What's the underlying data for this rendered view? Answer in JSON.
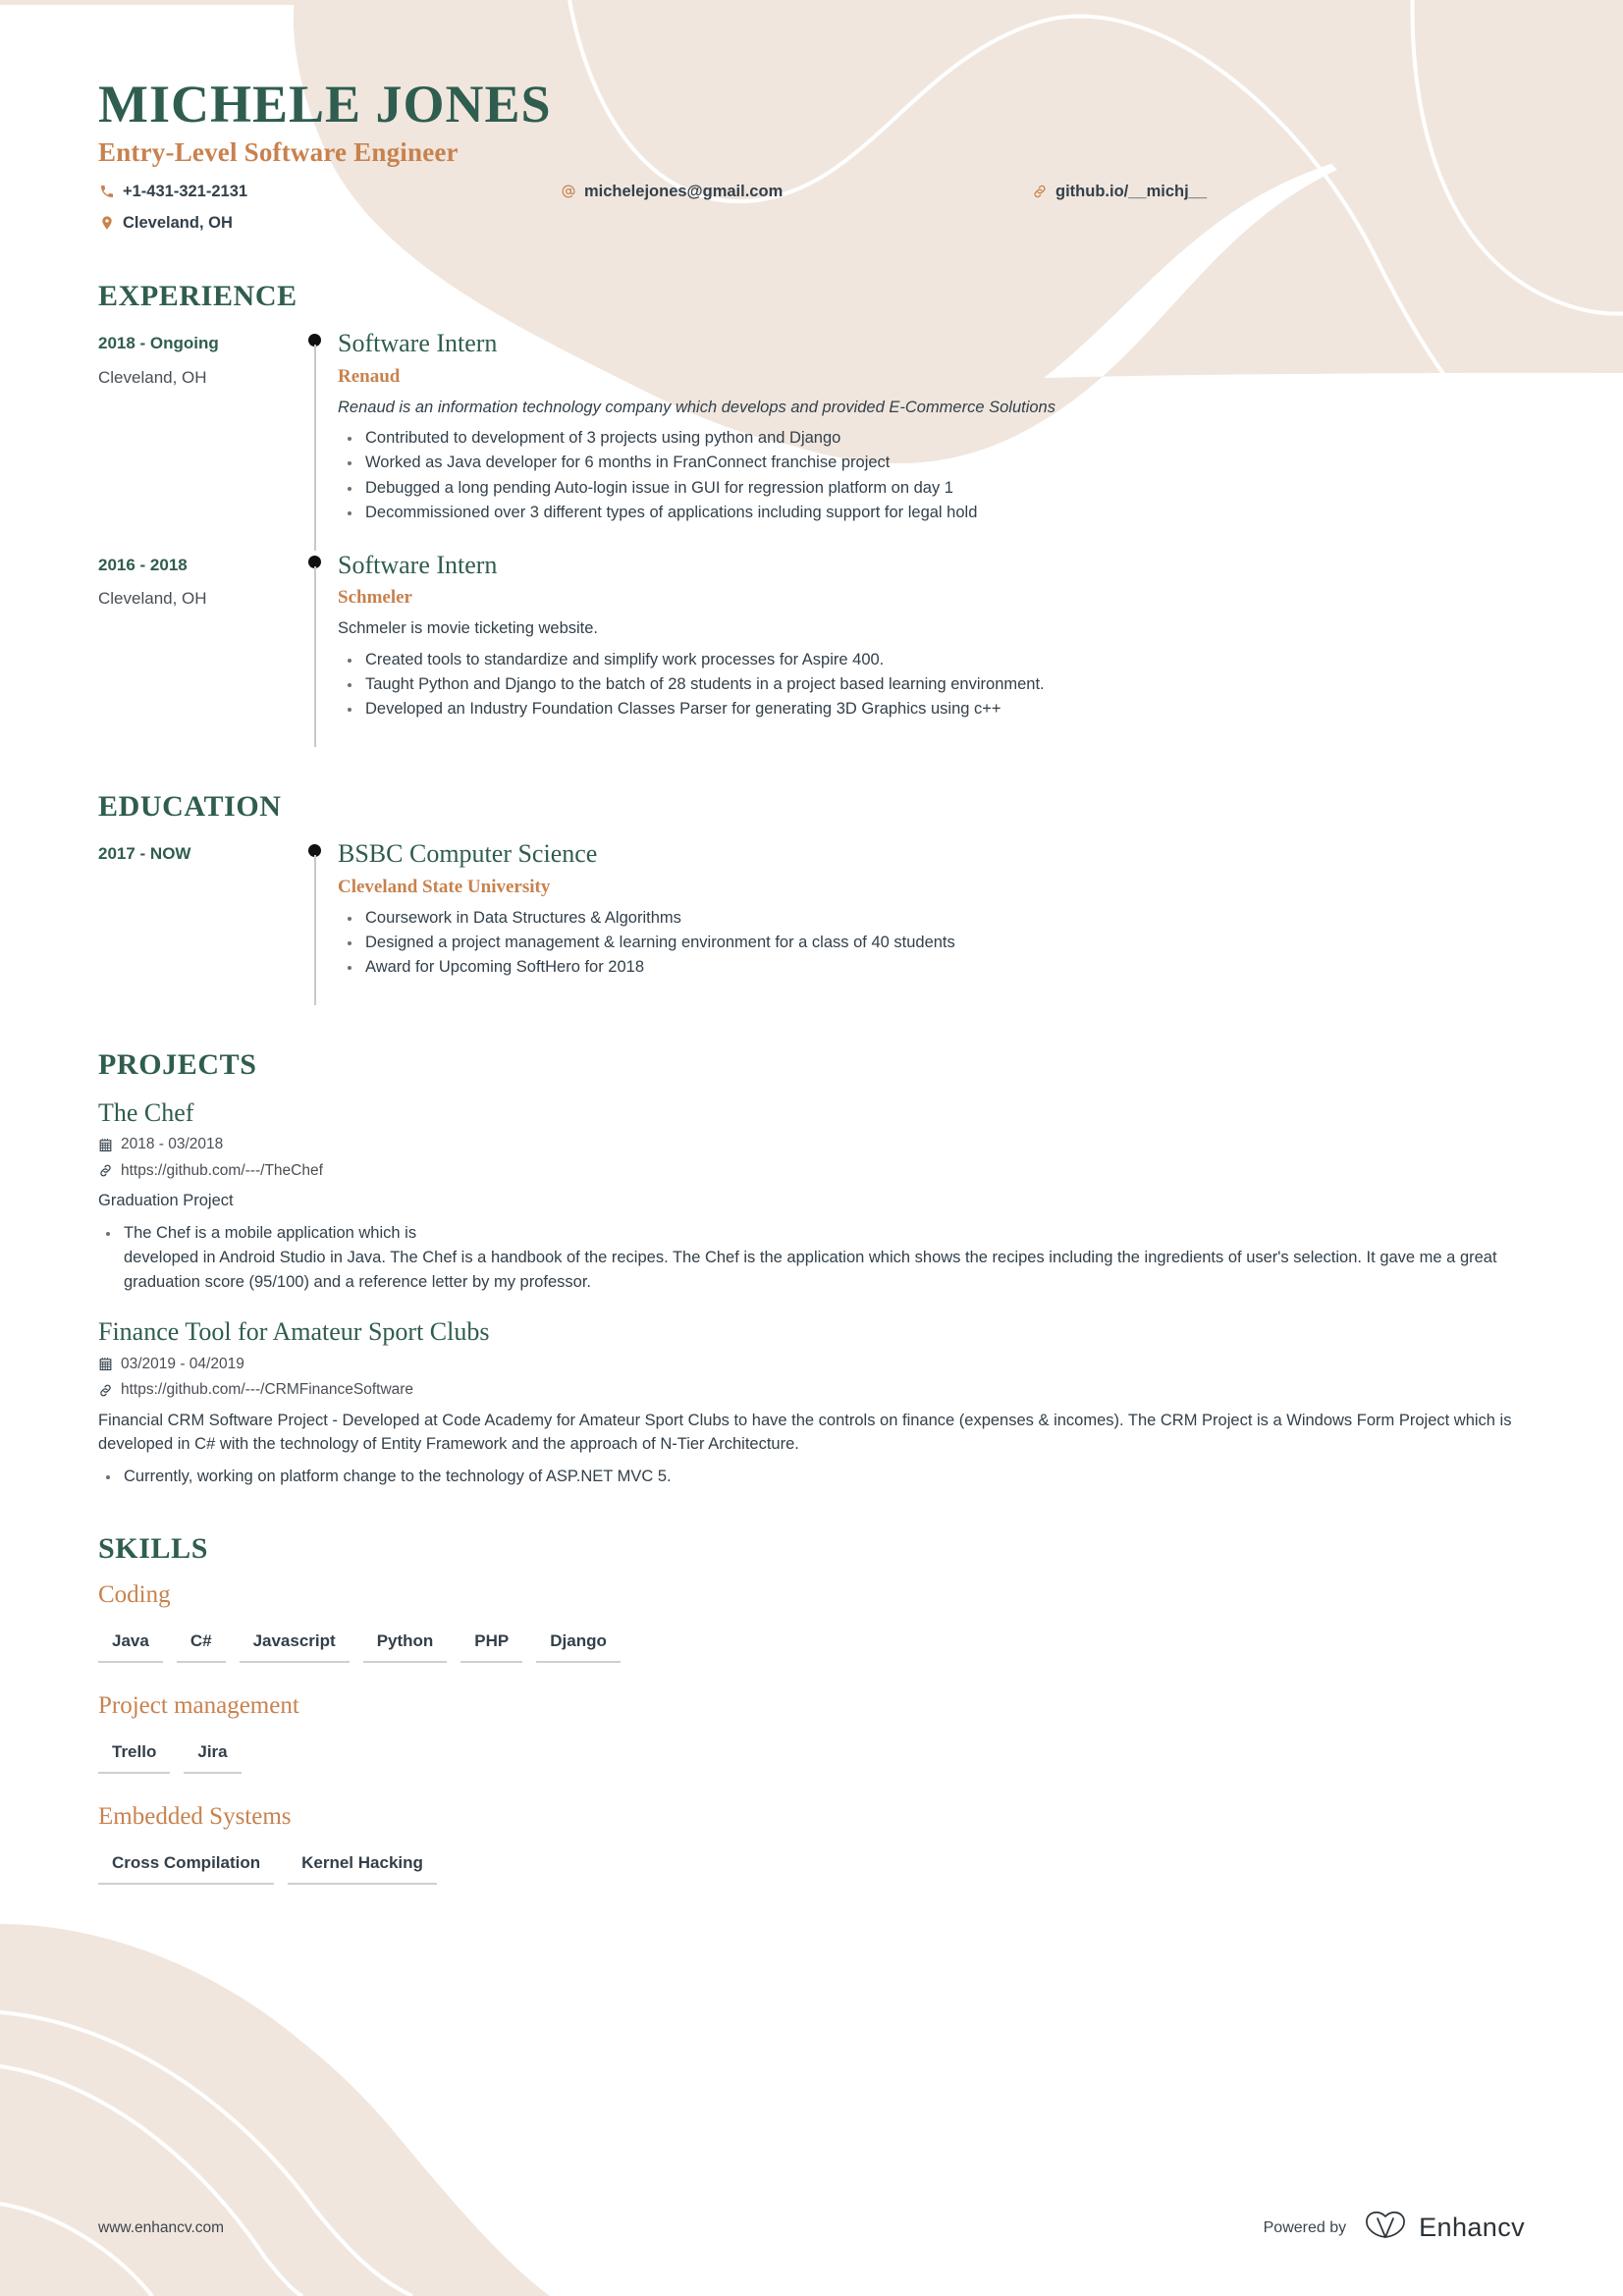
{
  "colors": {
    "green": "#2F5D50",
    "orange": "#C8824E",
    "beige": "#F0E6DE",
    "text": "#33404A",
    "rule": "#CFCFCF"
  },
  "header": {
    "name": "MICHELE JONES",
    "job_title": "Entry-Level Software Engineer",
    "contacts": {
      "phone": "+1-431-321-2131",
      "location": "Cleveland, OH",
      "email": "michelejones@gmail.com",
      "website": "github.io/__michj__"
    },
    "icons": {
      "phone": "phone-icon",
      "location": "map-pin-icon",
      "email": "at-sign-icon",
      "website": "link-icon"
    }
  },
  "sections": {
    "experience": {
      "title": "EXPERIENCE",
      "entries": [
        {
          "date": "2018 - Ongoing",
          "location": "Cleveland, OH",
          "role": "Software Intern",
          "organization": "Renaud",
          "summary": "Renaud is an information technology company which develops and provided E-Commerce Solutions",
          "summary_italic": true,
          "bullets": [
            "Contributed to development of 3 projects using python and Django",
            "Worked as Java developer for 6 months in FranConnect franchise project",
            "Debugged a long pending Auto-login issue in GUI for regression platform on day 1",
            "Decommissioned over 3 different types of applications including support for legal hold"
          ]
        },
        {
          "date": "2016 - 2018",
          "location": "Cleveland, OH",
          "role": "Software Intern",
          "organization": "Schmeler",
          "summary": "Schmeler is movie ticketing website.",
          "summary_italic": false,
          "bullets": [
            "Created tools to standardize and simplify work processes for Aspire 400.",
            "Taught Python and Django to the batch of 28 students in a project based learning environment.",
            "Developed an Industry Foundation Classes Parser for generating 3D Graphics using c++"
          ]
        }
      ]
    },
    "education": {
      "title": "EDUCATION",
      "entries": [
        {
          "date": "2017 - NOW",
          "location": "",
          "role": "BSBC Computer Science",
          "organization": "Cleveland State University",
          "summary": "",
          "bullets": [
            "Coursework in Data Structures & Algorithms",
            "Designed a project management & learning environment for a class of 40 students",
            "Award for Upcoming SoftHero for 2018"
          ]
        }
      ]
    },
    "projects": {
      "title": "PROJECTS",
      "entries": [
        {
          "title": "The Chef",
          "date": "2018 - 03/2018",
          "link": "https://github.com/---/TheChef",
          "description": "Graduation Project",
          "bullets": [
            "The Chef is a mobile application which is\ndeveloped in Android Studio in Java. The Chef is a handbook of the recipes. The Chef is the application which shows the recipes including the ingredients of user's selection. It gave me a great graduation score (95/100) and a reference letter by my professor."
          ]
        },
        {
          "title": "Finance Tool for Amateur Sport Clubs",
          "date": "03/2019 - 04/2019",
          "link": "https://github.com/---/CRMFinanceSoftware",
          "description": "Financial CRM Software Project - Developed at Code Academy for Amateur Sport Clubs to have the controls on finance (expenses & incomes). The CRM Project is a Windows Form Project which is developed in C# with the technology of Entity Framework and the approach of N-Tier Architecture.",
          "bullets": [
            "Currently, working on platform change to the technology of ASP.NET MVC 5."
          ]
        }
      ]
    },
    "skills": {
      "title": "SKILLS",
      "categories": [
        {
          "name": "Coding",
          "items": [
            "Java",
            "C#",
            "Javascript",
            "Python",
            "PHP",
            "Django"
          ]
        },
        {
          "name": "Project management",
          "items": [
            "Trello",
            "Jira"
          ]
        },
        {
          "name": "Embedded Systems",
          "items": [
            "Cross Compilation",
            "Kernel Hacking"
          ]
        }
      ]
    }
  },
  "footer": {
    "url": "www.enhancv.com",
    "powered_by": "Powered by",
    "brand": "Enhancv",
    "brand_icon": "enhancv-logo-icon"
  }
}
